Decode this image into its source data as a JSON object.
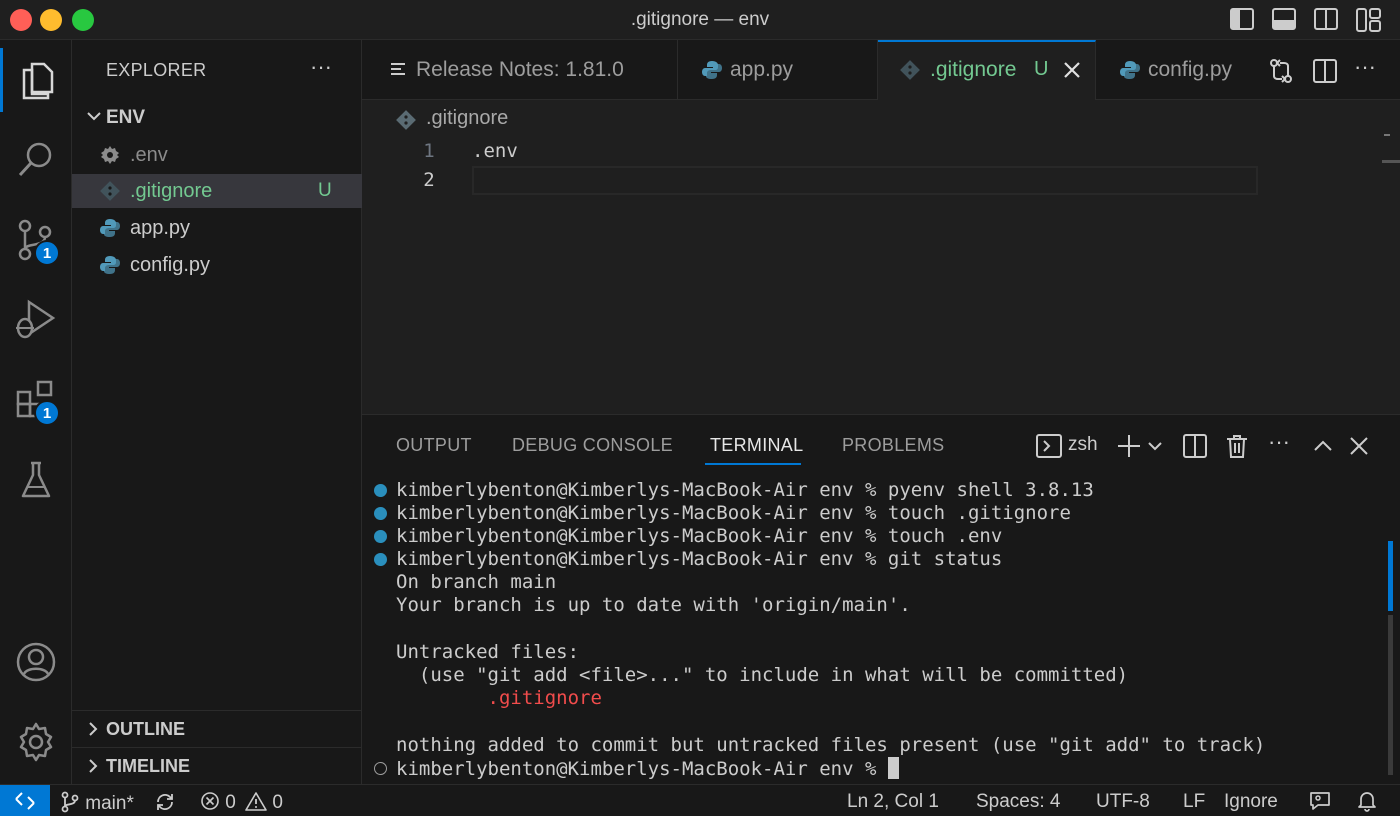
{
  "window": {
    "title": ".gitignore — env"
  },
  "activity_bar": {
    "source_control_badge": "1",
    "extensions_badge": "1"
  },
  "sidebar": {
    "title": "EXPLORER",
    "more": "···",
    "folder": "ENV",
    "files": [
      {
        "name": ".env",
        "icon": "gear-icon",
        "color": "#8b8b8b",
        "status": ""
      },
      {
        "name": ".gitignore",
        "icon": "git-icon",
        "color": "#73c991",
        "status": "U",
        "selected": true
      },
      {
        "name": "app.py",
        "icon": "python-icon",
        "color": "#cccccc",
        "status": ""
      },
      {
        "name": "config.py",
        "icon": "python-icon",
        "color": "#cccccc",
        "status": ""
      }
    ],
    "outline": "OUTLINE",
    "timeline": "TIMELINE"
  },
  "tabs": [
    {
      "label": "Release Notes: 1.81.0",
      "icon": "list-icon"
    },
    {
      "label": "app.py",
      "icon": "python-icon"
    },
    {
      "label": ".gitignore",
      "icon": "git-icon",
      "status": "U",
      "active": true
    },
    {
      "label": "config.py",
      "icon": "python-icon"
    }
  ],
  "editor": {
    "breadcrumb": ".gitignore",
    "lines": [
      {
        "num": "1",
        "text": ".env"
      },
      {
        "num": "2",
        "text": ""
      }
    ]
  },
  "panel": {
    "tabs": [
      "OUTPUT",
      "DEBUG CONSOLE",
      "TERMINAL",
      "PROBLEMS"
    ],
    "active_tab": "TERMINAL",
    "shell": "zsh",
    "terminal_lines": [
      "kimberlybenton@Kimberlys-MacBook-Air env % pyenv shell 3.8.13",
      "kimberlybenton@Kimberlys-MacBook-Air env % touch .gitignore",
      "kimberlybenton@Kimberlys-MacBook-Air env % touch .env",
      "kimberlybenton@Kimberlys-MacBook-Air env % git status",
      "On branch main",
      "Your branch is up to date with 'origin/main'.",
      "",
      "Untracked files:",
      "  (use \"git add <file>...\" to include in what will be committed)",
      "        .gitignore",
      "",
      "nothing added to commit but untracked files present (use \"git add\" to track)",
      "kimberlybenton@Kimberlys-MacBook-Air env % "
    ]
  },
  "statusbar": {
    "branch": "main*",
    "errors": "0",
    "warnings": "0",
    "position": "Ln 2, Col 1",
    "spaces": "Spaces: 4",
    "encoding": "UTF-8",
    "eol": "LF",
    "ignore": "Ignore"
  },
  "colors": {
    "accent": "#0078d4",
    "untracked": "#73c991",
    "error_text": "#f14c4c"
  }
}
